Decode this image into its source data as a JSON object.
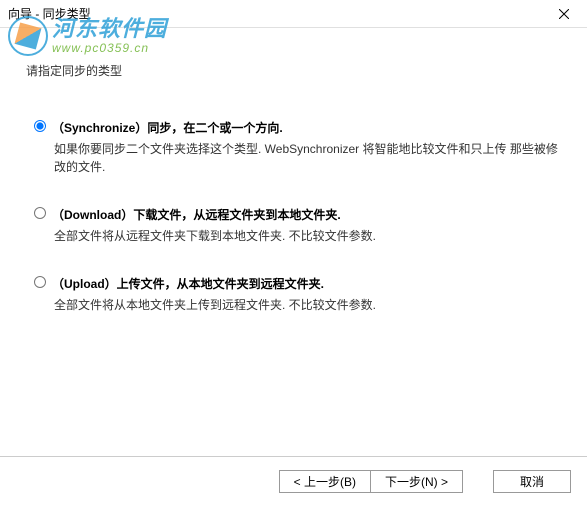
{
  "titlebar": {
    "title": "向导 - 同步类型"
  },
  "watermark": {
    "cn": "河东软件园",
    "url": "www.pc0359.cn"
  },
  "instruction": "请指定同步的类型",
  "options": [
    {
      "title": "（Synchronize）同步，在二个或一个方向.",
      "desc": "如果你要同步二个文件夹选择这个类型. WebSynchronizer 将智能地比较文件和只上传 那些被修改的文件.",
      "checked": true
    },
    {
      "title": "（Download）下载文件，从远程文件夹到本地文件夹.",
      "desc": "全部文件将从远程文件夹下载到本地文件夹. 不比较文件参数.",
      "checked": false
    },
    {
      "title": "（Upload）上传文件，从本地文件夹到远程文件夹.",
      "desc": "全部文件将从本地文件夹上传到远程文件夹. 不比较文件参数.",
      "checked": false
    }
  ],
  "buttons": {
    "back": "< 上一步(B)",
    "next": "下一步(N) >",
    "cancel": "取消"
  }
}
